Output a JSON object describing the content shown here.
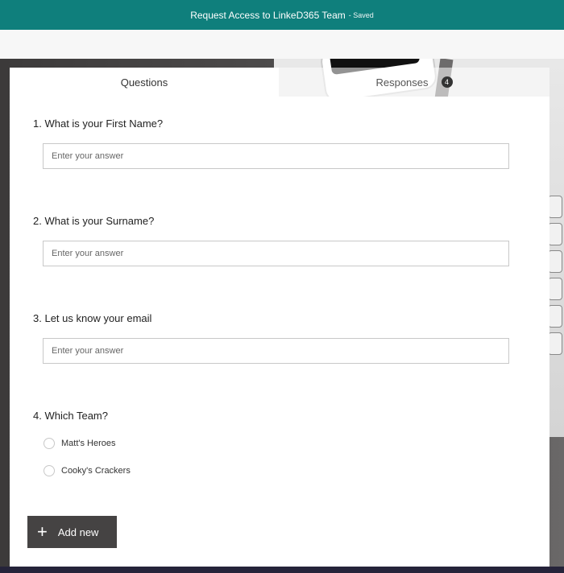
{
  "header": {
    "title": "Request Access to LinkeD365 Team",
    "separator": "-",
    "status": "Saved"
  },
  "tabs": [
    {
      "label": "Questions",
      "active": true
    },
    {
      "label": "Responses",
      "badge": "4",
      "active": false
    }
  ],
  "questions": [
    {
      "number": "1.",
      "text": "What is your First Name?",
      "type": "text",
      "placeholder": "Enter your answer"
    },
    {
      "number": "2.",
      "text": "What is your Surname?",
      "type": "text",
      "placeholder": "Enter your answer"
    },
    {
      "number": "3.",
      "text": "Let us know your email",
      "type": "text",
      "placeholder": "Enter your answer"
    },
    {
      "number": "4.",
      "text": "Which Team?",
      "type": "choice",
      "options": [
        "Matt's Heroes",
        "Cooky's Crackers"
      ]
    }
  ],
  "actions": {
    "add_new_label": "Add new",
    "add_new_icon": "plus-icon"
  },
  "colors": {
    "header_bg": "#0f7f7c",
    "button_bg": "#454343"
  }
}
